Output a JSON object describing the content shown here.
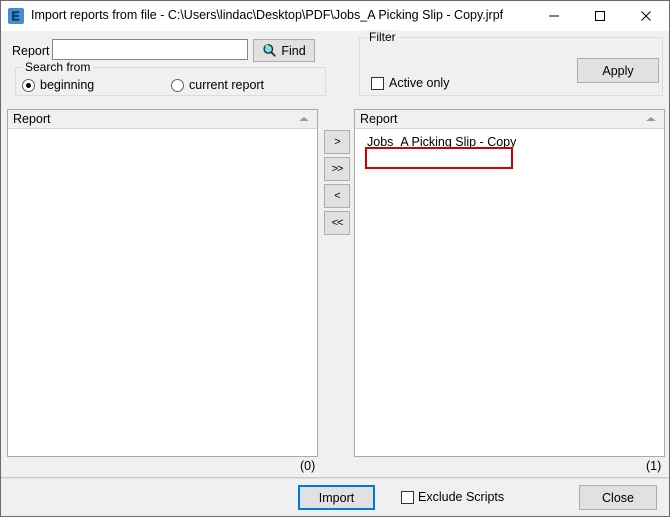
{
  "window": {
    "title": "Import reports from file - C:\\Users\\lindac\\Desktop\\PDF\\Jobs_A Picking Slip - Copy.jrpf",
    "icon": "app-icon",
    "controls": {
      "minimize": "minimize-icon",
      "maximize": "maximize-icon",
      "close": "close-icon"
    }
  },
  "search": {
    "label": "Report",
    "input_value": "",
    "input_placeholder": "",
    "find_button": "Find",
    "find_icon": "magnifier-icon",
    "group_title": "Search from",
    "options": [
      {
        "label": "beginning",
        "selected": true
      },
      {
        "label": "current report",
        "selected": false
      }
    ]
  },
  "filter": {
    "group_title": "Filter",
    "active_only": {
      "label": "Active only",
      "checked": false
    },
    "apply_button": "Apply"
  },
  "lists": {
    "left": {
      "header": "Report",
      "sort": "ascending",
      "items": [],
      "count": "(0)"
    },
    "right": {
      "header": "Report",
      "sort": "ascending",
      "items": [
        "Jobs_A Picking Slip - Copy"
      ],
      "count": "(1)",
      "highlight": "#d40000"
    }
  },
  "transfer": {
    "move_right": ">",
    "move_all_right": ">>",
    "move_left": "<",
    "move_all_left": "<<"
  },
  "footer": {
    "import_button": "Import",
    "exclude_scripts": {
      "label": "Exclude Scripts",
      "checked": false
    },
    "close_button": "Close"
  },
  "colors": {
    "focus_blue": "#0078d7",
    "highlight_red": "#d40000",
    "window_bg": "#f0f0f0"
  }
}
